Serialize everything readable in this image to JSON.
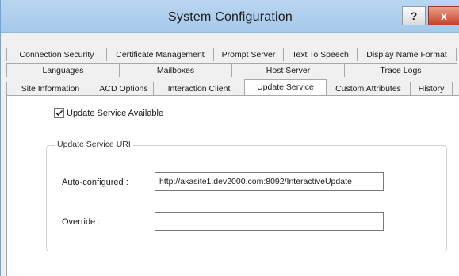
{
  "window": {
    "title": "System Configuration",
    "help_label": "?",
    "close_label": "x"
  },
  "tabs": {
    "row1": [
      "Connection Security",
      "Certificate Management",
      "Prompt Server",
      "Text To Speech",
      "Display Name Format"
    ],
    "row2": [
      "Languages",
      "Mailboxes",
      "Host Server",
      "Trace Logs"
    ],
    "row3": [
      "Site Information",
      "ACD Options",
      "Interaction Client",
      "Update Service",
      "Custom Attributes",
      "History"
    ],
    "active": "Update Service"
  },
  "update_service": {
    "checkbox_label": "Update Service Available",
    "checkbox_checked": true,
    "group_title": "Update Service URI",
    "auto_configured_label": "Auto-configured :",
    "auto_configured_value": "http://akasite1.dev2000.com:8092/InteractiveUpdate",
    "override_label": "Override :",
    "override_value": ""
  }
}
